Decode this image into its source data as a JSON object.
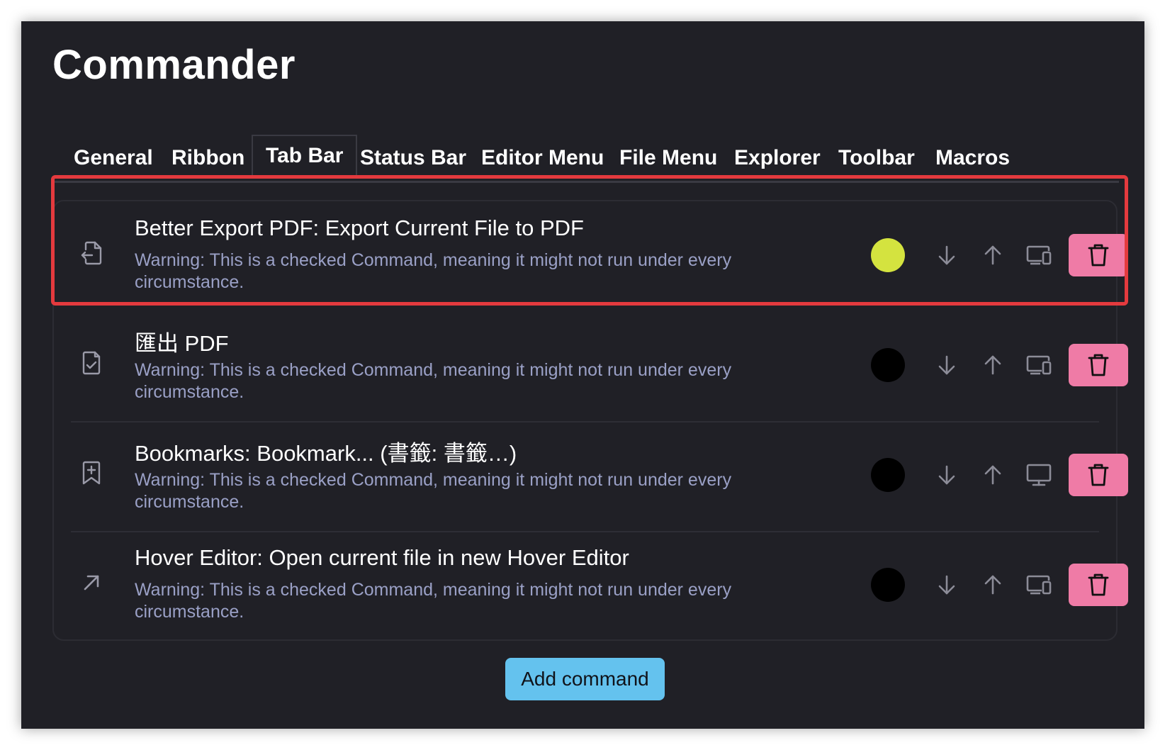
{
  "app": {
    "title": "Commander"
  },
  "tabs": [
    {
      "label": "General"
    },
    {
      "label": "Ribbon"
    },
    {
      "label": "Tab Bar",
      "active": true
    },
    {
      "label": "Status Bar"
    },
    {
      "label": "Editor Menu"
    },
    {
      "label": "File Menu"
    },
    {
      "label": "Explorer"
    },
    {
      "label": "Toolbar"
    },
    {
      "label": "Macros"
    }
  ],
  "commands": [
    {
      "title": "Better Export PDF: Export Current File to PDF",
      "warning": "Warning: This is a checked Command, meaning it might not run under every circumstance.",
      "icon": "file-export-icon",
      "color": "#d4e33f",
      "mode_icon": "devices-icon",
      "highlighted": true
    },
    {
      "title": "匯出 PDF",
      "warning": "Warning: This is a checked Command, meaning it might not run under every circumstance.",
      "icon": "file-check-icon",
      "color": "#000000",
      "mode_icon": "devices-icon"
    },
    {
      "title": "Bookmarks: Bookmark... (書籤: 書籤…)",
      "warning": "Warning: This is a checked Command, meaning it might not run under every circumstance.",
      "icon": "bookmark-plus-icon",
      "color": "#000000",
      "mode_icon": "desktop-icon"
    },
    {
      "title": "Hover Editor: Open current file in new Hover Editor",
      "warning": "Warning: This is a checked Command, meaning it might not run under every circumstance.",
      "icon": "arrow-up-right-icon",
      "color": "#000000",
      "mode_icon": "devices-icon"
    }
  ],
  "add_button": {
    "label": "Add command"
  },
  "colors": {
    "background": "#202026",
    "delete_button": "#ef7ba6",
    "add_button": "#64c2ee",
    "warning_text": "#9aa0c6",
    "highlight_border": "#e43a3e"
  }
}
